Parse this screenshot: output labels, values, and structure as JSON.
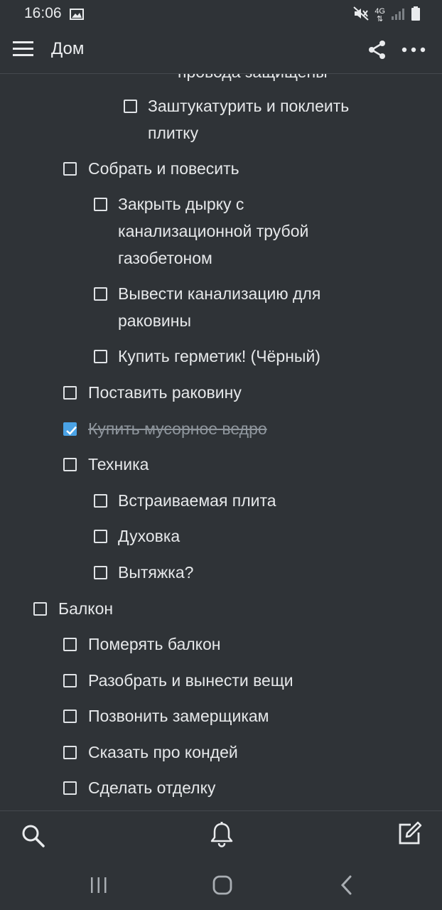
{
  "status_bar": {
    "time": "16:06",
    "network": "4G",
    "icons": [
      "image-icon",
      "mute-icon",
      "network-4g-icon",
      "signal-icon",
      "battery-icon"
    ]
  },
  "app_bar": {
    "title": "Дом",
    "icons": [
      "menu-icon",
      "share-icon",
      "more-icon"
    ]
  },
  "checklist": [
    {
      "text": "провода защищены",
      "checked": false,
      "partial": true
    },
    {
      "text": "Заштукатурить и поклеить",
      "text2": "плитку",
      "checked": false
    },
    {
      "text": "Собрать и повесить",
      "checked": false
    },
    {
      "text": "Закрыть дырку с",
      "text2": "канализационной трубой",
      "text3": "газобетоном",
      "checked": false
    },
    {
      "text": "Вывести канализацию для",
      "text2": "раковины",
      "checked": false
    },
    {
      "text": "Купить герметик! (Чёрный)",
      "checked": false
    },
    {
      "text": "Поставить раковину",
      "checked": false
    },
    {
      "text": "Купить мусорное ведро",
      "checked": true
    },
    {
      "text": "Техника",
      "checked": false
    },
    {
      "text": "Встраиваемая плита",
      "checked": false
    },
    {
      "text": "Духовка",
      "checked": false
    },
    {
      "text": "Вытяжка?",
      "checked": false
    },
    {
      "text": "Балкон",
      "checked": false
    },
    {
      "text": "Померять балкон",
      "checked": false
    },
    {
      "text": "Разобрать и вынести вещи",
      "checked": false
    },
    {
      "text": "Позвонить замерщикам",
      "checked": false
    },
    {
      "text": "Сказать про кондей",
      "checked": false
    },
    {
      "text": "Сделать отделку",
      "checked": false
    }
  ],
  "bottom_bar": {
    "icons": [
      "search-icon",
      "bell-icon",
      "new-note-icon"
    ]
  },
  "nav_bar": {
    "icons": [
      "recents-icon",
      "home-icon",
      "back-icon"
    ]
  },
  "colors": {
    "background": "#2f3337",
    "accent": "#4aa3e6",
    "text": "#e6e8ea",
    "done_text": "#8e959c"
  }
}
